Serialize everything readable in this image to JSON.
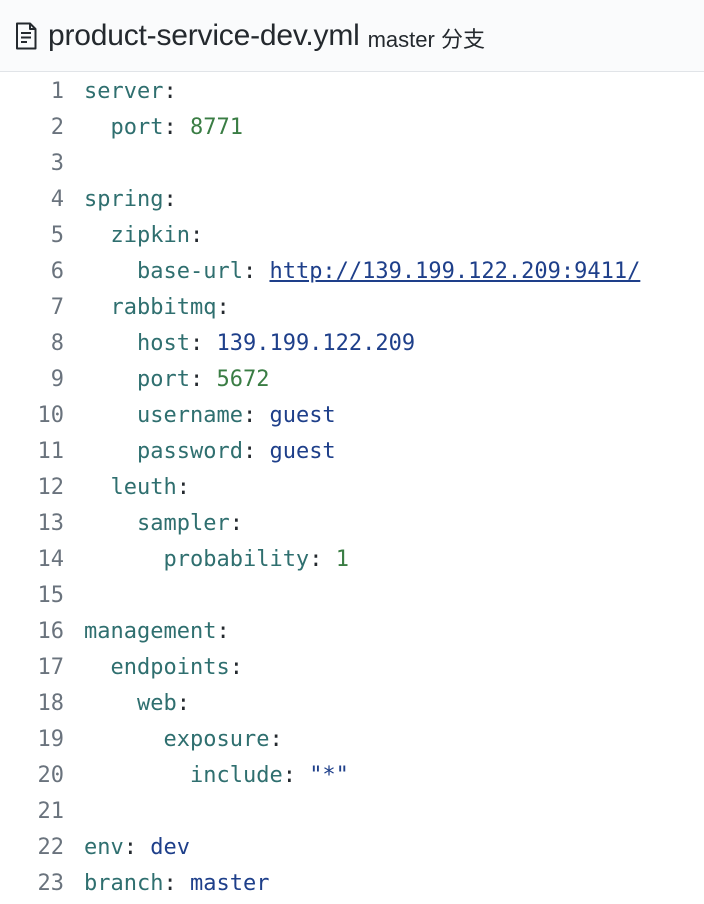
{
  "header": {
    "icon": "file-icon",
    "filename": "product-service-dev.yml",
    "branch_info": "master 分支"
  },
  "colors": {
    "key": "#2f6f6f",
    "number": "#3a7d44",
    "string": "#1e3f8a",
    "line_number": "#6a737d"
  },
  "lines": [
    {
      "n": "1",
      "indent": 0,
      "key": "server",
      "value": "",
      "vtype": ""
    },
    {
      "n": "2",
      "indent": 1,
      "key": "port",
      "value": "8771",
      "vtype": "num"
    },
    {
      "n": "3",
      "indent": 0,
      "key": "",
      "value": "",
      "vtype": ""
    },
    {
      "n": "4",
      "indent": 0,
      "key": "spring",
      "value": "",
      "vtype": ""
    },
    {
      "n": "5",
      "indent": 1,
      "key": "zipkin",
      "value": "",
      "vtype": ""
    },
    {
      "n": "6",
      "indent": 2,
      "key": "base-url",
      "value": "http://139.199.122.209:9411/",
      "vtype": "url"
    },
    {
      "n": "7",
      "indent": 1,
      "key": "rabbitmq",
      "value": "",
      "vtype": ""
    },
    {
      "n": "8",
      "indent": 2,
      "key": "host",
      "value": "139.199.122.209",
      "vtype": "str"
    },
    {
      "n": "9",
      "indent": 2,
      "key": "port",
      "value": "5672",
      "vtype": "num"
    },
    {
      "n": "10",
      "indent": 2,
      "key": "username",
      "value": "guest",
      "vtype": "str"
    },
    {
      "n": "11",
      "indent": 2,
      "key": "password",
      "value": "guest",
      "vtype": "str"
    },
    {
      "n": "12",
      "indent": 1,
      "key": "leuth",
      "value": "",
      "vtype": ""
    },
    {
      "n": "13",
      "indent": 2,
      "key": "sampler",
      "value": "",
      "vtype": ""
    },
    {
      "n": "14",
      "indent": 3,
      "key": "probability",
      "value": "1",
      "vtype": "num"
    },
    {
      "n": "15",
      "indent": 0,
      "key": "",
      "value": "",
      "vtype": ""
    },
    {
      "n": "16",
      "indent": 0,
      "key": "management",
      "value": "",
      "vtype": ""
    },
    {
      "n": "17",
      "indent": 1,
      "key": "endpoints",
      "value": "",
      "vtype": ""
    },
    {
      "n": "18",
      "indent": 2,
      "key": "web",
      "value": "",
      "vtype": ""
    },
    {
      "n": "19",
      "indent": 3,
      "key": "exposure",
      "value": "",
      "vtype": ""
    },
    {
      "n": "20",
      "indent": 4,
      "key": "include",
      "value": "\"*\"",
      "vtype": "str"
    },
    {
      "n": "21",
      "indent": 0,
      "key": "",
      "value": "",
      "vtype": ""
    },
    {
      "n": "22",
      "indent": 0,
      "key": "env",
      "value": "dev",
      "vtype": "str"
    },
    {
      "n": "23",
      "indent": 0,
      "key": "branch",
      "value": "master",
      "vtype": "str"
    }
  ]
}
